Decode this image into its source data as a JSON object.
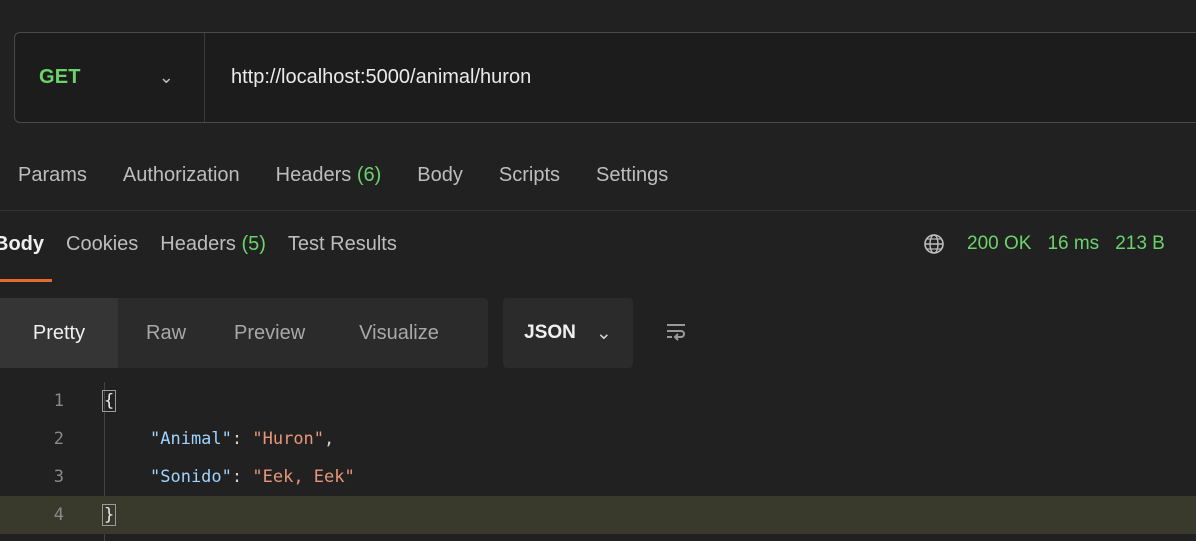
{
  "request": {
    "method": "GET",
    "url": "http://localhost:5000/animal/huron"
  },
  "request_tabs": [
    {
      "label": "Params"
    },
    {
      "label": "Authorization"
    },
    {
      "label": "Headers",
      "count": "(6)"
    },
    {
      "label": "Body"
    },
    {
      "label": "Scripts"
    },
    {
      "label": "Settings"
    }
  ],
  "response_tabs": [
    {
      "label": "Body"
    },
    {
      "label": "Cookies"
    },
    {
      "label": "Headers",
      "count": "(5)"
    },
    {
      "label": "Test Results"
    }
  ],
  "response_status": {
    "status": "200 OK",
    "time": "16 ms",
    "size": "213 B",
    "icon": "globe-icon"
  },
  "view_tabs": [
    "Pretty",
    "Raw",
    "Preview",
    "Visualize"
  ],
  "format_select": "JSON",
  "code_lines": [
    {
      "num": "1",
      "text": "{"
    },
    {
      "num": "2",
      "key": "\"Animal\"",
      "sep": ": ",
      "value": "\"Huron\"",
      "tail": ","
    },
    {
      "num": "3",
      "key": "\"Sonido\"",
      "sep": ": ",
      "value": "\"Eek, Eek\"",
      "tail": ""
    },
    {
      "num": "4",
      "text": "}"
    }
  ],
  "colors": {
    "accent": "#e06c2d",
    "method_green": "#6bd36b",
    "key_blue": "#9fd3ff",
    "string_orange": "#e8977a"
  }
}
